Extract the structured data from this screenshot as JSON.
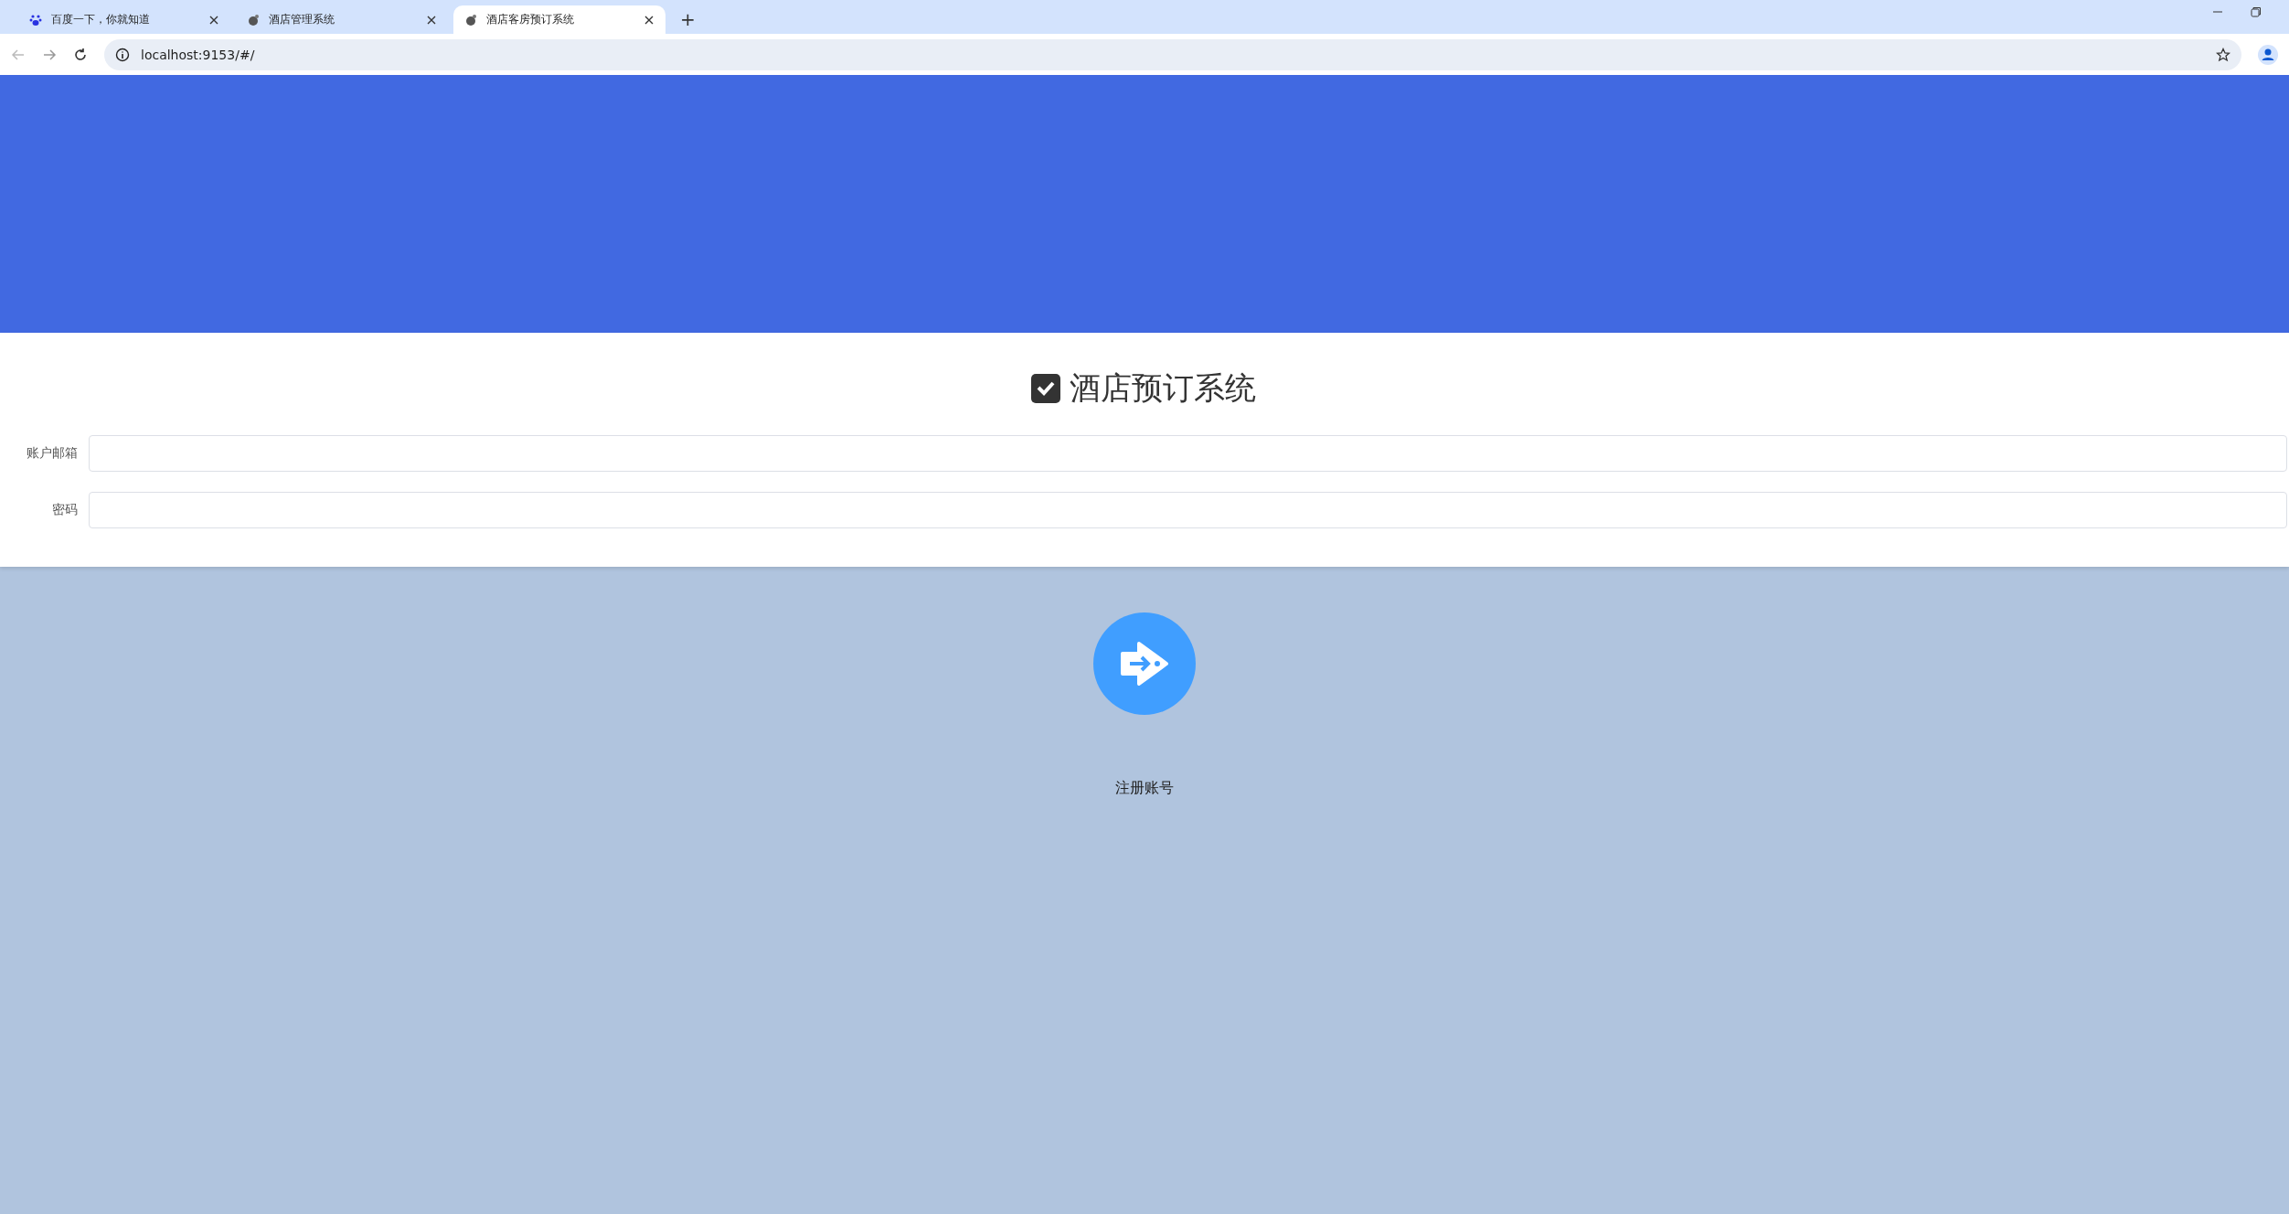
{
  "browser": {
    "tabs": [
      {
        "title": "百度一下，你就知道",
        "selected": false,
        "kind": "paw"
      },
      {
        "title": "酒店管理系统",
        "selected": false,
        "kind": "app"
      },
      {
        "title": "酒店客房预订系统",
        "selected": true,
        "kind": "app"
      }
    ],
    "new_tab": "+",
    "url": "localhost:9153/#/"
  },
  "login": {
    "title": "酒店预订系统",
    "fields": [
      {
        "label": "账户邮箱"
      },
      {
        "label": "密码"
      }
    ]
  },
  "register": {
    "label": "注册账号"
  }
}
